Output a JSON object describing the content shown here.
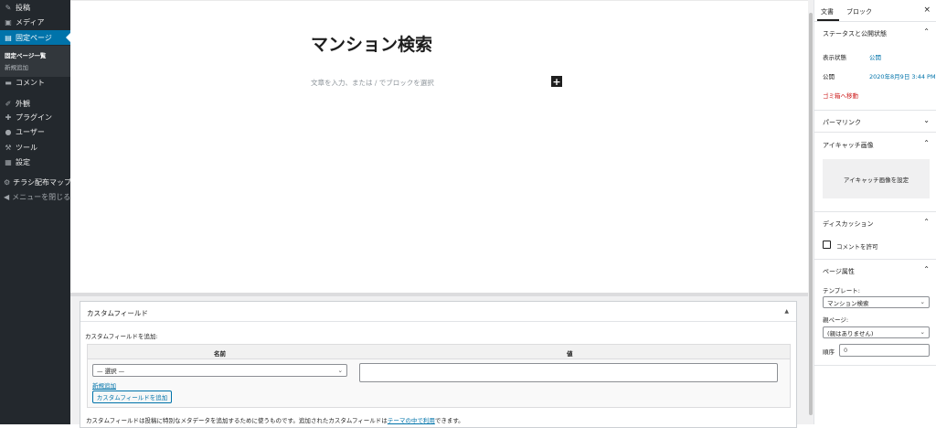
{
  "admin_menu": {
    "items": [
      {
        "icon": "pushpin-icon",
        "glyph": "✎",
        "label": "投稿"
      },
      {
        "icon": "media-icon",
        "glyph": "▣",
        "label": "メディア"
      },
      {
        "icon": "page-icon",
        "glyph": "▤",
        "label": "固定ページ"
      },
      {
        "icon": "comment-icon",
        "glyph": "▬",
        "label": "コメント"
      },
      {
        "icon": "appearance-icon",
        "glyph": "✐",
        "label": "外観"
      },
      {
        "icon": "plugin-icon",
        "glyph": "✚",
        "label": "プラグイン"
      },
      {
        "icon": "user-icon",
        "glyph": "●",
        "label": "ユーザー"
      },
      {
        "icon": "wrench-icon",
        "glyph": "⚒",
        "label": "ツール"
      },
      {
        "icon": "settings-icon",
        "glyph": "▦",
        "label": "設定"
      },
      {
        "icon": "gear-icon",
        "glyph": "⚙",
        "label": "チラシ配布マップ"
      },
      {
        "icon": "collapse-icon",
        "glyph": "◀",
        "label": "メニューを閉じる"
      }
    ],
    "submenu": {
      "all_pages": "固定ページ一覧",
      "add_new": "新規追加"
    }
  },
  "editor": {
    "title": "マンション検索",
    "placeholder": "文章を入力、または / でブロックを選択",
    "inserter_glyph": "+"
  },
  "custom_fields": {
    "title": "カスタムフィールド",
    "toggle": "▲",
    "add_heading": "カスタムフィールドを追加:",
    "col_name": "名前",
    "col_value": "値",
    "select_value": "— 選択 —",
    "select_chevron": "⌄",
    "new_link": "新規追加",
    "add_button": "カスタムフィールドを追加",
    "help_text": "カスタムフィールドは投稿に特別なメタデータを追加するために使うものです。追加されたカスタムフィールドは",
    "help_link": "テーマの中で利用",
    "help_suffix": "できます。"
  },
  "sidebar": {
    "tabs": {
      "document": "文書",
      "block": "ブロック",
      "close": "×"
    },
    "status": {
      "title": "ステータスと公開状態",
      "visibility_label": "表示状態",
      "visibility_value": "公開",
      "publish_label": "公開",
      "publish_value": "2020年8月9日 3:44 PM",
      "trash": "ゴミ箱へ移動"
    },
    "permalink": {
      "title": "パーマリンク"
    },
    "featured": {
      "title": "アイキャッチ画像",
      "button": "アイキャッチ画像を設定"
    },
    "discussion": {
      "title": "ディスカッション",
      "allow_comments": "コメントを許可"
    },
    "page_attributes": {
      "title": "ページ属性",
      "template_label": "テンプレート:",
      "template_value": "マンション検索",
      "parent_label": "親ページ:",
      "parent_value": "(親はありません)",
      "order_label": "順序",
      "order_value": "0"
    },
    "chev_up": "⌃",
    "chev_down": "⌄"
  },
  "colors": {
    "admin_bg": "#23282d",
    "accent": "#0073aa",
    "danger": "#cc1818"
  }
}
